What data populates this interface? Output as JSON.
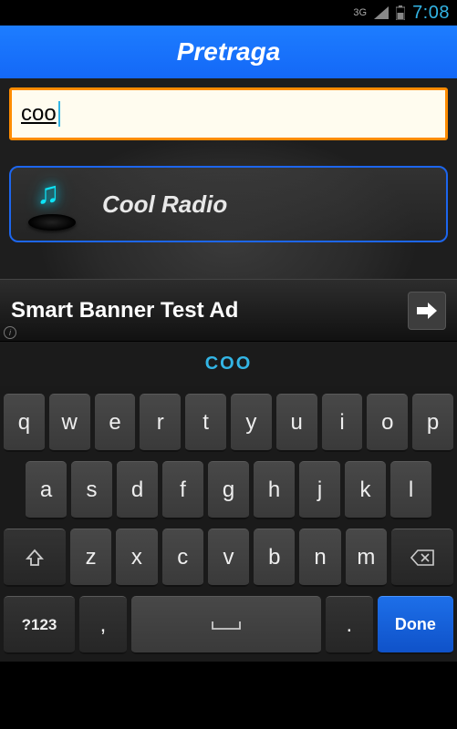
{
  "status": {
    "network": "3G",
    "time": "7:08"
  },
  "header": {
    "title": "Pretraga"
  },
  "search": {
    "value": "coo"
  },
  "result": {
    "label": "Cool Radio"
  },
  "ad": {
    "text": "Smart Banner Test Ad"
  },
  "keyboard": {
    "suggestion": "COO",
    "row1": [
      "q",
      "w",
      "e",
      "r",
      "t",
      "y",
      "u",
      "i",
      "o",
      "p"
    ],
    "row2": [
      "a",
      "s",
      "d",
      "f",
      "g",
      "h",
      "j",
      "k",
      "l"
    ],
    "row3": [
      "z",
      "x",
      "c",
      "v",
      "b",
      "n",
      "m"
    ],
    "sym": "?123",
    "comma": ",",
    "period": ".",
    "done": "Done"
  }
}
